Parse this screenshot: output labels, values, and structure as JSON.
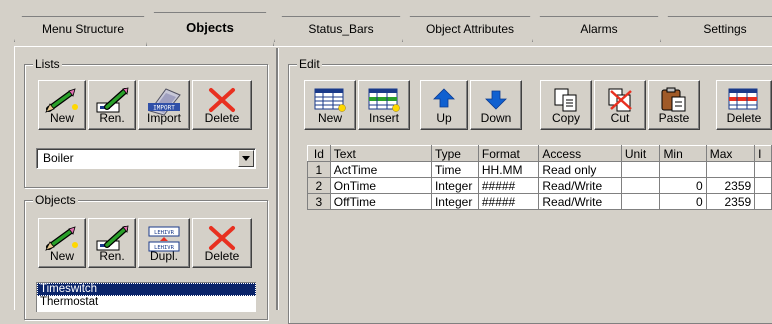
{
  "tabs": [
    {
      "label": "Menu Structure",
      "active": false
    },
    {
      "label": "Objects",
      "active": true
    },
    {
      "label": "Status_Bars",
      "active": false
    },
    {
      "label": "Object Attributes",
      "active": false
    },
    {
      "label": "Alarms",
      "active": false
    },
    {
      "label": "Settings",
      "active": false
    }
  ],
  "lists": {
    "title": "Lists",
    "buttons": {
      "new": "New",
      "rename": "Ren.",
      "import": "Import",
      "delete": "Delete"
    },
    "selected": "Boiler"
  },
  "objects": {
    "title": "Objects",
    "buttons": {
      "new": "New",
      "rename": "Ren.",
      "duplicate": "Dupl.",
      "delete": "Delete"
    },
    "items": [
      "Timeswitch",
      "Thermostat"
    ],
    "selected_index": 0
  },
  "edit": {
    "title": "Edit",
    "buttons": {
      "new": "New",
      "insert": "Insert",
      "up": "Up",
      "down": "Down",
      "copy": "Copy",
      "cut": "Cut",
      "paste": "Paste",
      "delete": "Delete"
    }
  },
  "icon_text": {
    "import": "IMPORT",
    "dupl_top": "LEHIVR",
    "dupl_bottom": "LEHIVR"
  },
  "table": {
    "columns": [
      "Id",
      "Text",
      "Type",
      "Format",
      "Access",
      "Unit",
      "Min",
      "Max",
      "I"
    ],
    "rows": [
      [
        "1",
        "ActTime",
        "Time",
        "HH.MM",
        "Read only",
        "",
        "",
        "",
        ""
      ],
      [
        "2",
        "OnTime",
        "Integer",
        "#####",
        "Read/Write",
        "",
        "0",
        "2359",
        ""
      ],
      [
        "3",
        "OffTime",
        "Integer",
        "#####",
        "Read/Write",
        "",
        "0",
        "2359",
        ""
      ]
    ]
  },
  "colors": {
    "face": "#d4d0c8",
    "selection": "#0a246a",
    "arrow_blue": "#1060d0",
    "delete_red": "#e83020"
  }
}
